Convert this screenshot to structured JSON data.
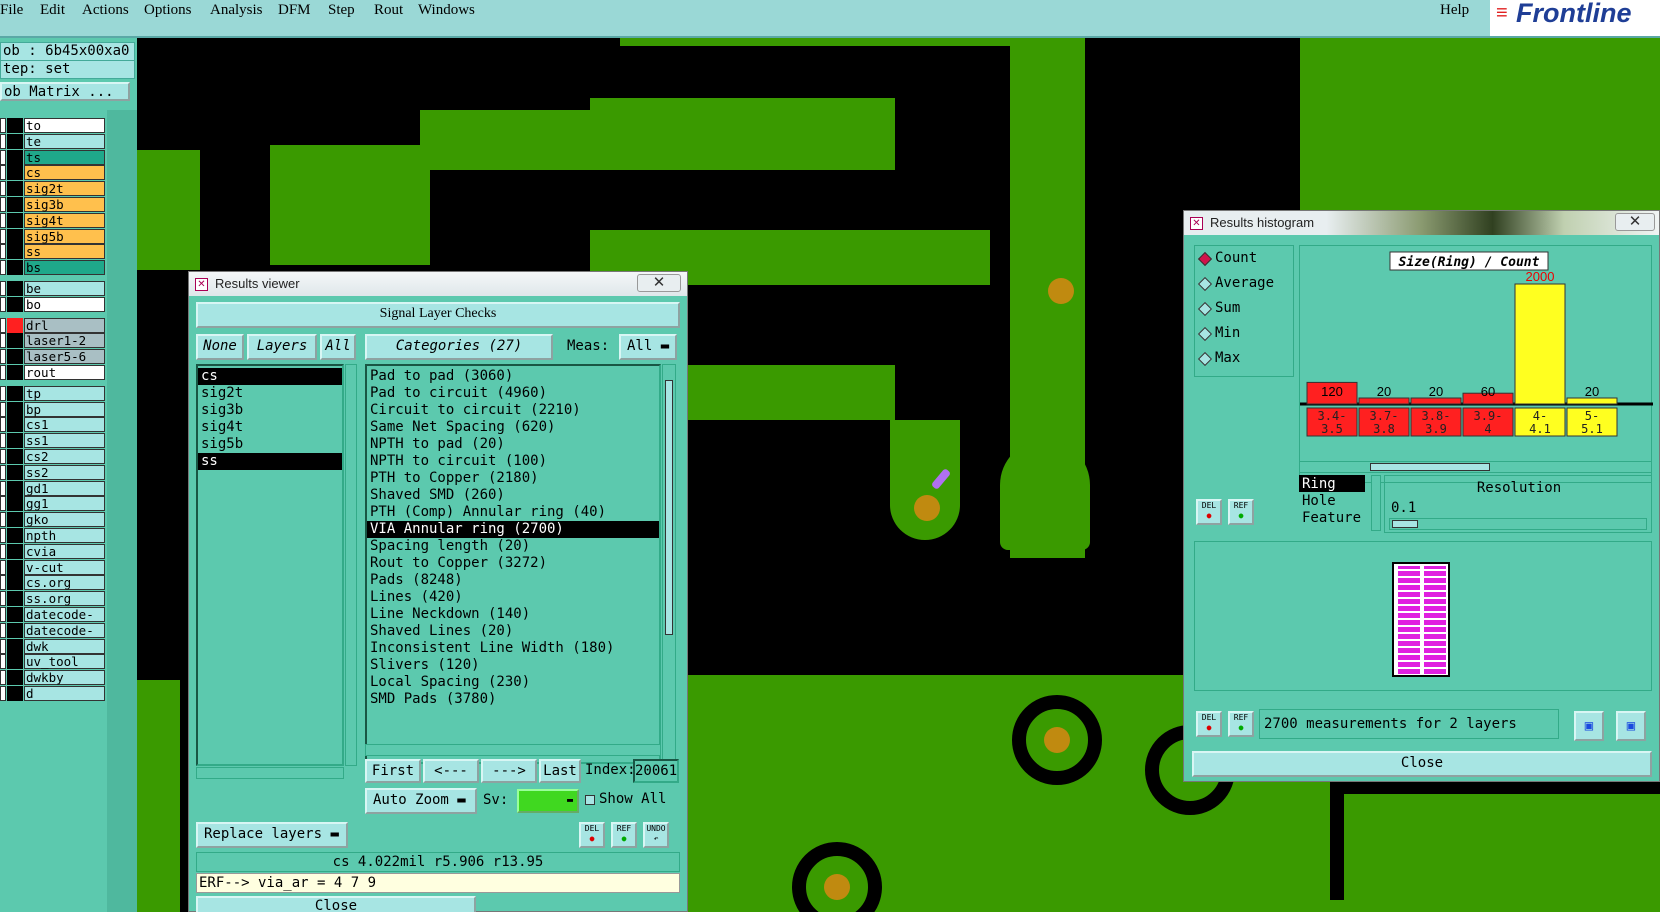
{
  "menu": [
    "File",
    "Edit",
    "Actions",
    "Options",
    "Analysis",
    "DFM",
    "Step",
    "Rout",
    "Windows"
  ],
  "help": "Help",
  "logo": "Frontline",
  "left": {
    "job": "ob : 6b45x00xa0",
    "step": "tep: set",
    "matrix": "ob Matrix ...",
    "layers": [
      {
        "name": "to",
        "bg": "#ffffff"
      },
      {
        "name": "te",
        "bg": "#a7e5e3"
      },
      {
        "name": "ts",
        "bg": "#1fa88a"
      },
      {
        "name": "cs",
        "bg": "#ffc04d"
      },
      {
        "name": "sig2t",
        "bg": "#ffc04d"
      },
      {
        "name": "sig3b",
        "bg": "#ffc04d"
      },
      {
        "name": "sig4t",
        "bg": "#ffc04d"
      },
      {
        "name": "sig5b",
        "bg": "#ffc04d"
      },
      {
        "name": "ss",
        "bg": "#ffc04d"
      },
      {
        "name": "bs",
        "bg": "#1fa88a"
      },
      {
        "name": "be",
        "bg": "#a7e5e3"
      },
      {
        "name": "bo",
        "bg": "#ffffff"
      },
      {
        "name": "drl",
        "bg": "#a9bfc4"
      },
      {
        "name": "laser1-2",
        "bg": "#a9bfc4"
      },
      {
        "name": "laser5-6",
        "bg": "#a9bfc4"
      },
      {
        "name": "rout",
        "bg": "#ffffff"
      },
      {
        "name": "tp",
        "bg": "#a7e5e3"
      },
      {
        "name": "bp",
        "bg": "#a7e5e3"
      },
      {
        "name": "cs1",
        "bg": "#a7e5e3"
      },
      {
        "name": "ss1",
        "bg": "#a7e5e3"
      },
      {
        "name": "cs2",
        "bg": "#a7e5e3"
      },
      {
        "name": "ss2",
        "bg": "#a7e5e3"
      },
      {
        "name": "gd1",
        "bg": "#a7e5e3"
      },
      {
        "name": "gg1",
        "bg": "#a7e5e3"
      },
      {
        "name": "gko",
        "bg": "#a7e5e3"
      },
      {
        "name": "npth",
        "bg": "#a7e5e3"
      },
      {
        "name": "cvia",
        "bg": "#a7e5e3"
      },
      {
        "name": "v-cut",
        "bg": "#a7e5e3"
      },
      {
        "name": "cs.org",
        "bg": "#a7e5e3"
      },
      {
        "name": "ss.org",
        "bg": "#a7e5e3"
      },
      {
        "name": "datecode-ptc",
        "bg": "#a7e5e3"
      },
      {
        "name": "datecode-pbc",
        "bg": "#a7e5e3"
      },
      {
        "name": "dwk",
        "bg": "#a7e5e3"
      },
      {
        "name": "uv_tool",
        "bg": "#a7e5e3"
      },
      {
        "name": "dwkby",
        "bg": "#a7e5e3"
      },
      {
        "name": "d",
        "bg": "#a7e5e3"
      }
    ]
  },
  "viewer": {
    "title": "Results viewer",
    "heading": "Signal Layer Checks",
    "none": "None",
    "layers": "Layers",
    "all": "All",
    "categories_btn": "Categories (27)",
    "meas_label": "Meas:",
    "meas_value": "All",
    "layer_list": [
      "cs",
      "sig2t",
      "sig3b",
      "sig4t",
      "sig5b",
      "ss"
    ],
    "categories": [
      "Pad to pad (3060)",
      "Pad to circuit (4960)",
      "Circuit to circuit (2210)",
      "Same Net Spacing (620)",
      "NPTH to pad (20)",
      "NPTH to circuit (100)",
      "PTH to Copper (2180)",
      "Shaved SMD (260)",
      "PTH (Comp) Annular ring (40)",
      "VIA Annular ring (2700)",
      "Spacing length (20)",
      "Rout to Copper (3272)",
      "Pads (8248)",
      "Lines (420)",
      "Line Neckdown (140)",
      "Shaved Lines (20)",
      "Inconsistent Line Width (180)",
      "Slivers (120)",
      "Local Spacing (230)",
      "SMD Pads (3780)"
    ],
    "first": "First",
    "prev": "<---",
    "next": "--->",
    "last": "Last",
    "index_label": "Index:",
    "index_value": "20061",
    "autozoom": "Auto Zoom",
    "sv": "Sv:",
    "showall": "Show All",
    "replace": "Replace layers",
    "del": "DEL",
    "ref": "REF",
    "undo": "UNDO",
    "status": "cs 4.022mil  r5.906  r13.95",
    "erf": "ERF--> via_ar = 4 7 9",
    "close": "Close"
  },
  "hist": {
    "title": "Results histogram",
    "modes": [
      "Count",
      "Average",
      "Sum",
      "Min",
      "Max"
    ],
    "chart_title": "Size(Ring) / Count",
    "del": "DEL",
    "ref": "REF",
    "mtypes": [
      "Ring",
      "Hole",
      "Feature"
    ],
    "resolution_label": "Resolution",
    "resolution_value": "0.1",
    "summary": "2700 measurements for 2 layers",
    "close": "Close"
  },
  "chart_data": {
    "type": "bar",
    "title": "Size(Ring) / Count",
    "categories": [
      "3.4-3.5",
      "3.7-3.8",
      "3.8-3.9",
      "3.9-4",
      "4-4.1",
      "5-5.1"
    ],
    "values": [
      120,
      20,
      20,
      60,
      2000,
      20
    ],
    "bar_colors": [
      "#ff2020",
      "#ff2020",
      "#ff2020",
      "#ff2020",
      "#ffff20",
      "#ffff20"
    ],
    "ylim": [
      0,
      2000
    ]
  }
}
